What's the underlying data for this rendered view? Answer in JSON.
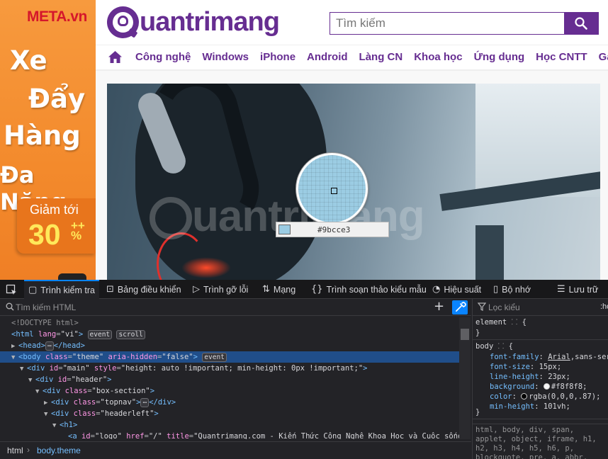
{
  "ad": {
    "brand": "META.vn",
    "line1": "Xe",
    "line2": "Đẩy",
    "line3": "Hàng",
    "line4": "Đa Năng",
    "promo_text": "Giảm tới",
    "promo_number": "30",
    "promo_suffix": "++",
    "promo_percent": "%",
    "bg_color": "#f38a2c",
    "brand_color": "#d5172b"
  },
  "site": {
    "logo_text": "uantrimang",
    "brand_color": "#662d91",
    "search_placeholder": "Tìm kiếm",
    "nav_items": [
      "Công nghệ",
      "Windows",
      "iPhone",
      "Android",
      "Làng CN",
      "Khoa học",
      "Ứng dụng",
      "Học CNTT",
      "Game"
    ],
    "watermark": "uantrimang"
  },
  "eyedropper": {
    "color_value": "#9bcce3"
  },
  "devtools": {
    "tabs": [
      {
        "label": "Trình kiểm tra",
        "icon": "inspector-icon",
        "active": true
      },
      {
        "label": "Bảng điều khiển",
        "icon": "console-icon",
        "active": false
      },
      {
        "label": "Trình gỡ lỗi",
        "icon": "debugger-icon",
        "active": false
      },
      {
        "label": "Mạng",
        "icon": "network-icon",
        "active": false
      },
      {
        "label": "Trình soạn thảo kiểu mẫu",
        "icon": "style-editor-icon",
        "active": false
      },
      {
        "label": "Hiệu suất",
        "icon": "performance-icon",
        "active": false
      },
      {
        "label": "Bộ nhớ",
        "icon": "memory-icon",
        "active": false
      },
      {
        "label": "Lưu trữ",
        "icon": "storage-icon",
        "active": false
      }
    ],
    "html_search_placeholder": "Tìm kiếm HTML",
    "filter_placeholder": "Lọc kiểu",
    "hov_label": ":ho",
    "breadcrumb": [
      "html",
      "body.theme"
    ],
    "tree": {
      "doctype": "<!DOCTYPE html>",
      "html_tag": "html",
      "html_lang_attr": "lang",
      "html_lang_val": "\"vi\"",
      "badge_event": "event",
      "badge_scroll": "scroll",
      "head_tag": "<head>",
      "head_close": "</head>",
      "ellipsis": "⋯",
      "body_tag": "body",
      "body_class_attr": "class",
      "body_class_val": "\"theme\"",
      "body_aria_attr": "aria-hidden",
      "body_aria_val": "\"false\"",
      "main_id_attr": "id",
      "main_id_val": "\"main\"",
      "main_style_attr": "style",
      "main_style_val": "\"height: auto !important; min-height: 0px !important;\"",
      "header_id_val": "\"header\"",
      "box_class_val": "\"box-section\"",
      "topnav_class_val": "\"topnav\"",
      "div_close": "</div>",
      "headerleft_class_val": "\"headerleft\"",
      "h1_tag": "h1",
      "a_tag": "a",
      "a_id_val": "\"logo\"",
      "a_href_attr": "href",
      "a_href_val": "\"/\"",
      "a_title_attr": "title",
      "a_title_val": "\"Quantrimang.com - Kiến Thức Công Nghệ Khoa Học và Cuộc sống\""
    },
    "rules": {
      "element_selector": "element",
      "body_selector": "body",
      "props": [
        {
          "name": "font-family",
          "value": "Arial,sans-serif",
          "link": "Arial"
        },
        {
          "name": "font-size",
          "value": "15px"
        },
        {
          "name": "line-height",
          "value": "23px"
        },
        {
          "name": "background",
          "value": "#f8f8f8",
          "swatch": "#f8f8f8"
        },
        {
          "name": "color",
          "value": "rgba(0,0,0,.87)",
          "swatch": "#000000"
        },
        {
          "name": "min-height",
          "value": "101vh"
        }
      ],
      "inherited": "html, body, div, span, applet, object, iframe, h1, h2, h3, h4, h5, h6, p, blockquote, pre, a, abbr, acronym, address, big, cite, code, del, dfn, em, img, ins, kbd"
    },
    "accent_color": "#0a84ff",
    "selected_row_color": "#204e8a"
  }
}
